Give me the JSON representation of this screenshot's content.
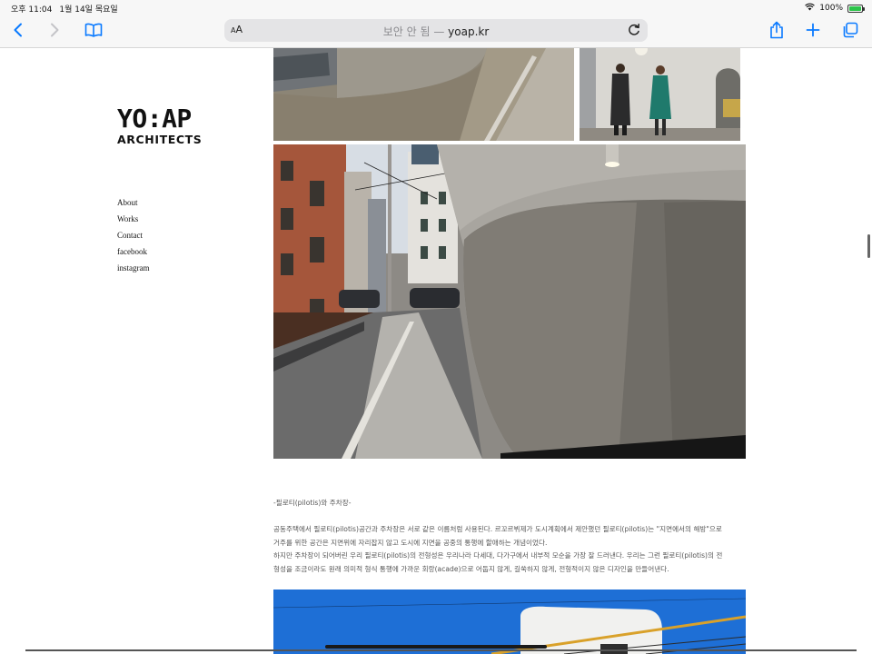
{
  "status_bar": {
    "time": "오후 11:04",
    "date": "1월 14일 목요일",
    "battery_percent": "100%",
    "battery_level": 1.0
  },
  "toolbar": {
    "aa_label_small": "A",
    "aa_label_large": "A",
    "security_label": "보안 안 됨",
    "separator": " — ",
    "domain": "yoap.kr",
    "icons": [
      "back-icon",
      "forward-icon",
      "bookmarks-icon",
      "reload-icon",
      "share-icon",
      "new-tab-icon",
      "tabs-icon"
    ]
  },
  "site": {
    "logo_line1": "YO:AP",
    "logo_line2": "ARCHITECTS",
    "nav": [
      "About",
      "Works",
      "Contact",
      "facebook",
      "instagram"
    ]
  },
  "article": {
    "subtitle": "-필로티(pilotis)와 주차장-",
    "paragraph": [
      "공동주택에서 필로티(pilotis)공간과 주차장은 서로 같은 이름처럼 사용된다. 르꼬르뷔제가 도시계획에서 제안했던 필로티(pilotis)는 \"지면에서의 해방\"으로",
      "거주를 위한 공간은 지면위에 자리잡지 않고 도시에 지면을 공중의 통행에 할애하는 개념이었다.",
      "하지만 주차장이 되어버린 우리 필로티(pilotis)의 전형성은 우리나라 다세대, 다가구에서 내부적 모순을 가장 잘 드러낸다. 우리는 그런 필로티(pilotis)의 전",
      "형성을 조금이라도 원래 의미적 형식 통행에 가까운 회랑(acade)으로 어둡지 않게, 길쑥하지 않게, 전형적이지 않은 디자인을 만들어낸다."
    ]
  },
  "colors": {
    "chrome_bg": "#f7f7f7",
    "address_bg": "#e4e4e6",
    "ios_blue": "#0a7aff",
    "battery_green": "#2cc44a",
    "sky_blue": "#1e6fd6"
  }
}
